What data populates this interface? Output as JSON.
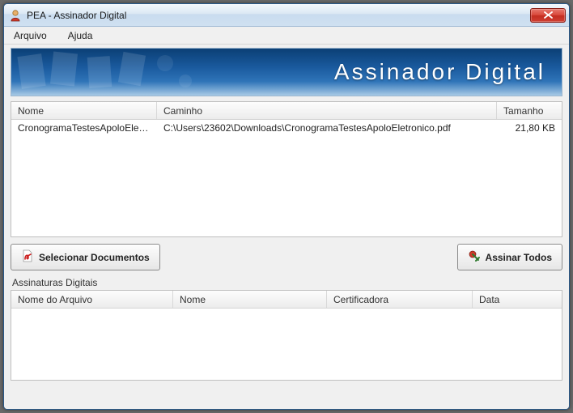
{
  "window": {
    "title": "PEA - Assinador Digital"
  },
  "menu": {
    "arquivo": "Arquivo",
    "ajuda": "Ajuda"
  },
  "banner": {
    "text": "Assinador Digital"
  },
  "docs_table": {
    "headers": {
      "nome": "Nome",
      "caminho": "Caminho",
      "tamanho": "Tamanho"
    },
    "rows": [
      {
        "nome": "CronogramaTestesApoloEletronic...",
        "caminho": "C:\\Users\\23602\\Downloads\\CronogramaTestesApoloEletronico.pdf",
        "tamanho": "21,80 KB"
      }
    ]
  },
  "buttons": {
    "select_docs": "Selecionar Documentos",
    "sign_all": "Assinar Todos"
  },
  "signatures": {
    "group_label": "Assinaturas Digitais",
    "headers": {
      "nome_arquivo": "Nome do Arquivo",
      "nome": "Nome",
      "certificadora": "Certificadora",
      "data": "Data"
    }
  }
}
